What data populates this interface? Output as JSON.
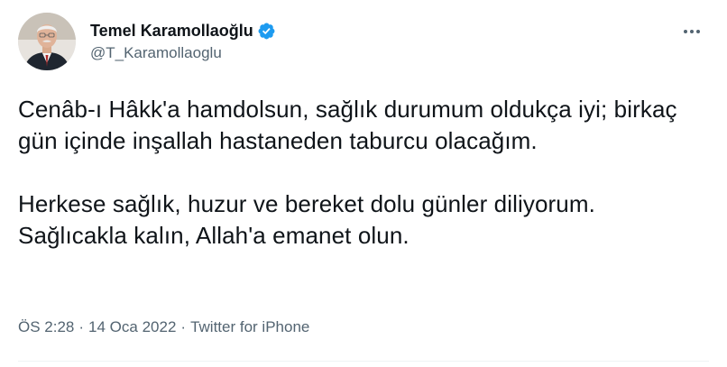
{
  "author": {
    "name": "Temel Karamollaoğlu",
    "handle": "@T_Karamollaoglu",
    "verified": true,
    "avatar_icon": "profile-photo"
  },
  "tweet": {
    "paragraphs": [
      "Cenâb-ı Hâkk'a hamdolsun, sağlık durumum oldukça iyi; birkaç gün içinde inşallah hastaneden taburcu olacağım.",
      "Herkese sağlık, huzur ve bereket dolu günler diliyorum. Sağlıcakla kalın, Allah'a emanet olun."
    ],
    "time": "ÖS 2:28",
    "date": "14 Oca 2022",
    "source": "Twitter for iPhone",
    "separator": "·"
  },
  "icons": {
    "more": "more-horizontal-icon",
    "verified": "verified-badge-icon"
  },
  "colors": {
    "verified_blue": "#1d9bf0",
    "text_primary": "#0f1419",
    "text_secondary": "#536471",
    "divider": "#eff3f4"
  }
}
